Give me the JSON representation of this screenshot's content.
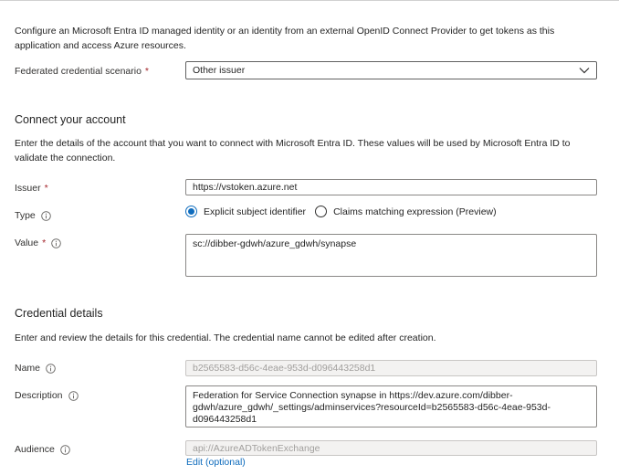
{
  "intro": "Configure an Microsoft Entra ID managed identity or an identity from an external OpenID Connect Provider to get tokens as this application and access Azure resources.",
  "scenario": {
    "label": "Federated credential scenario",
    "required": "*",
    "selected": "Other issuer"
  },
  "connect": {
    "title": "Connect your account",
    "description": "Enter the details of the account that you want to connect with Microsoft Entra ID. These values will be used by Microsoft Entra ID to validate the connection.",
    "issuer_label": "Issuer",
    "issuer_required": "*",
    "issuer_value": "https://vstoken.azure.net",
    "type_label": "Type",
    "type_options": [
      "Explicit subject identifier",
      "Claims matching expression (Preview)"
    ],
    "type_selected": "Explicit subject identifier",
    "value_label": "Value",
    "value_required": "*",
    "value_value": "sc://dibber-gdwh/azure_gdwh/synapse"
  },
  "credential": {
    "title": "Credential details",
    "description": "Enter and review the details for this credential. The credential name cannot be edited after creation.",
    "name_label": "Name",
    "name_value": "b2565583-d56c-4eae-953d-d096443258d1",
    "description_label": "Description",
    "description_value": "Federation for Service Connection synapse in https://dev.azure.com/dibber-gdwh/azure_gdwh/_settings/adminservices?resourceId=b2565583-d56c-4eae-953d-d096443258d1",
    "audience_label": "Audience",
    "audience_value": "api://AzureADTokenExchange",
    "edit_link": "Edit (optional)"
  },
  "icons": {
    "info": "info-icon",
    "chevron": "chevron-down-icon"
  },
  "colors": {
    "accent": "#0f6cbd",
    "required": "#a4262c"
  }
}
